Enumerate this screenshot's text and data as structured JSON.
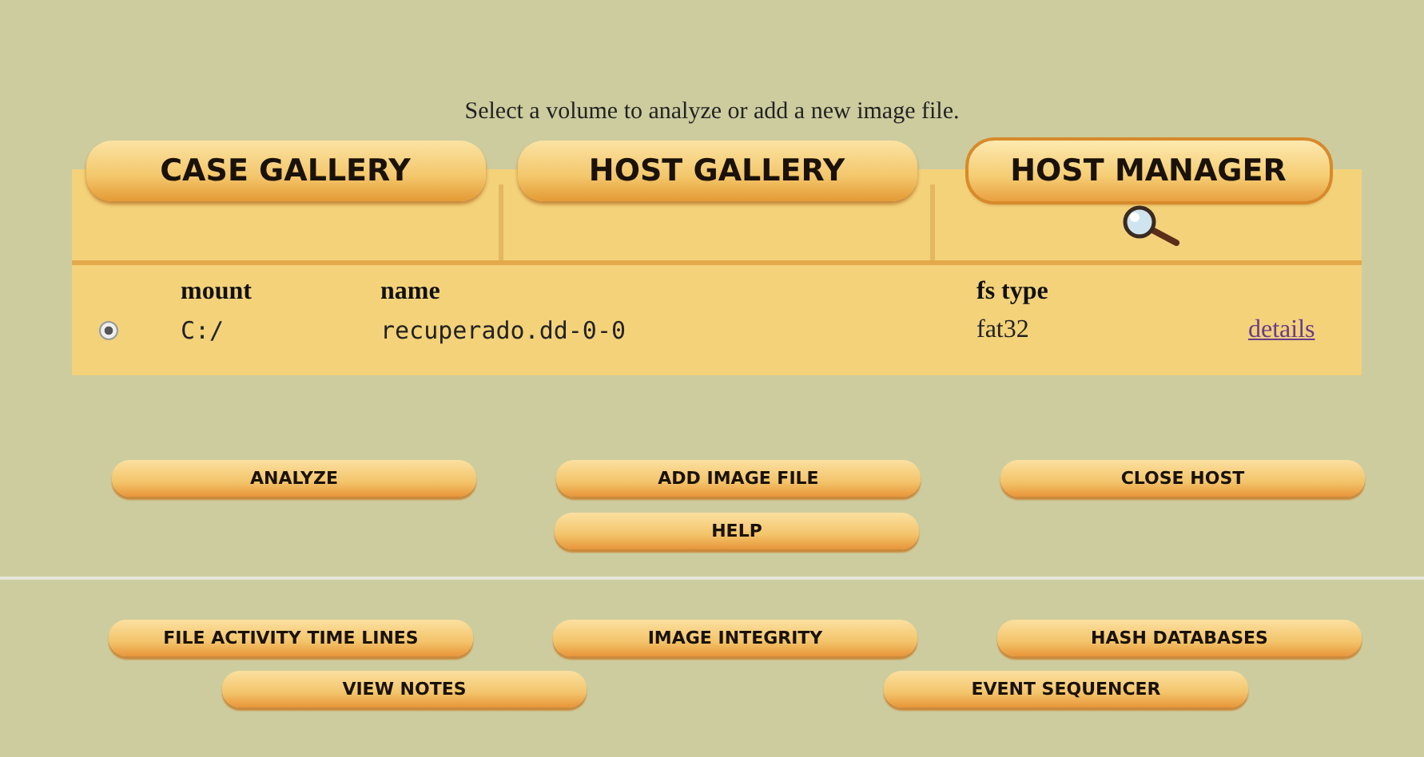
{
  "message": "Select a volume to analyze or add a new image file.",
  "tabs": [
    {
      "label": "CASE GALLERY",
      "selected": false
    },
    {
      "label": "HOST GALLERY",
      "selected": false
    },
    {
      "label": "HOST MANAGER",
      "selected": true
    }
  ],
  "table": {
    "columns": [
      "mount",
      "name",
      "fs type"
    ],
    "rows": [
      {
        "selected": true,
        "mount": "C:/",
        "name": "recuperado.dd-0-0",
        "fs_type": "fat32",
        "link": "details"
      }
    ]
  },
  "action_buttons": [
    [
      "ANALYZE",
      "ADD IMAGE FILE",
      "CLOSE HOST"
    ],
    [
      "HELP"
    ]
  ],
  "tool_buttons": [
    [
      "FILE ACTIVITY TIME LINES",
      "IMAGE INTEGRITY",
      "HASH DATABASES"
    ],
    [
      "VIEW NOTES",
      "EVENT SEQUENCER"
    ]
  ]
}
